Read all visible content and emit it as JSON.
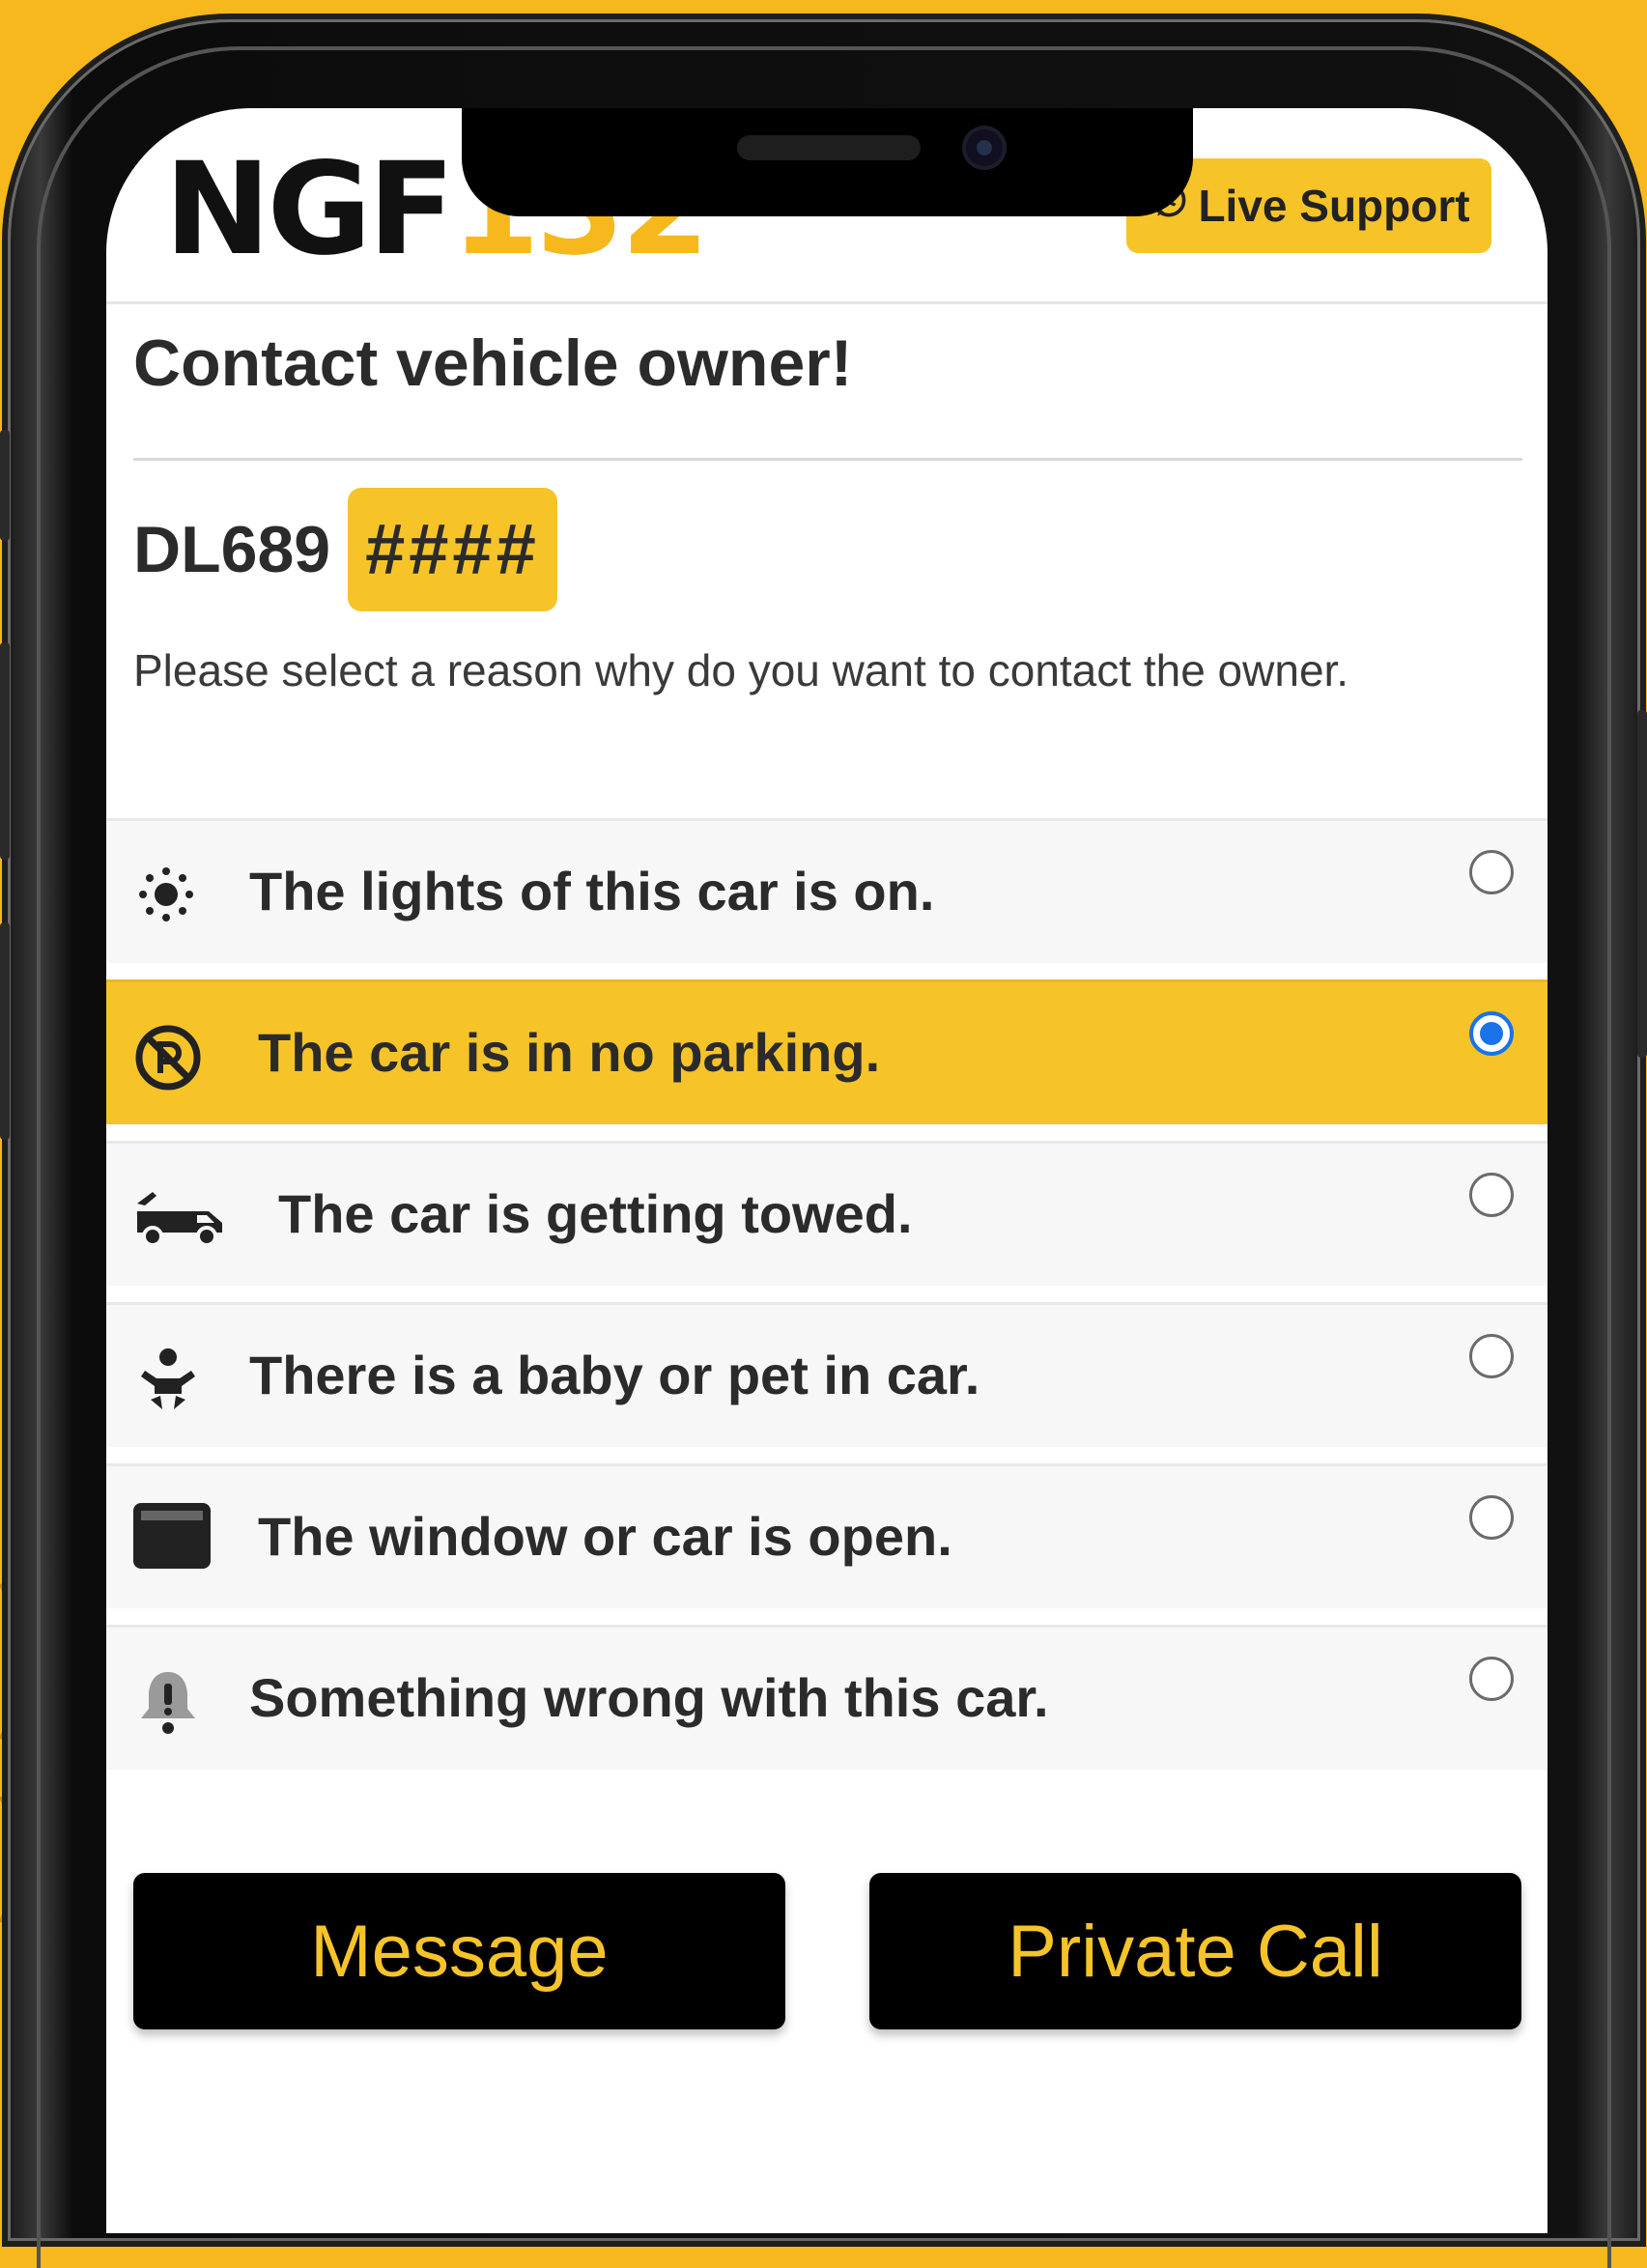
{
  "colors": {
    "accent": "#f6c429",
    "background": "#f6b81c",
    "radio_selected": "#1a73e8",
    "button_bg": "#000000"
  },
  "header": {
    "logo_text_dark": "NGF",
    "logo_text_accent": "132",
    "support_label": "Live Support",
    "support_icon": "whatsapp-icon"
  },
  "page": {
    "title": "Contact vehicle owner!",
    "plate_prefix": "DL689",
    "plate_masked": "####",
    "instruction": "Please select a reason why do you want to contact the owner."
  },
  "options": [
    {
      "icon": "lights-icon",
      "label": "The lights of this car is on.",
      "selected": false
    },
    {
      "icon": "no-parking-icon",
      "label": "The car is in no parking.",
      "selected": true
    },
    {
      "icon": "tow-truck-icon",
      "label": "The car is getting towed.",
      "selected": false
    },
    {
      "icon": "baby-icon",
      "label": "There is a baby or pet in car.",
      "selected": false
    },
    {
      "icon": "window-icon",
      "label": "The window or car is open.",
      "selected": false
    },
    {
      "icon": "alert-bell-icon",
      "label": "Something wrong with this car.",
      "selected": false
    }
  ],
  "actions": {
    "message_label": "Message",
    "call_label": "Private Call"
  }
}
